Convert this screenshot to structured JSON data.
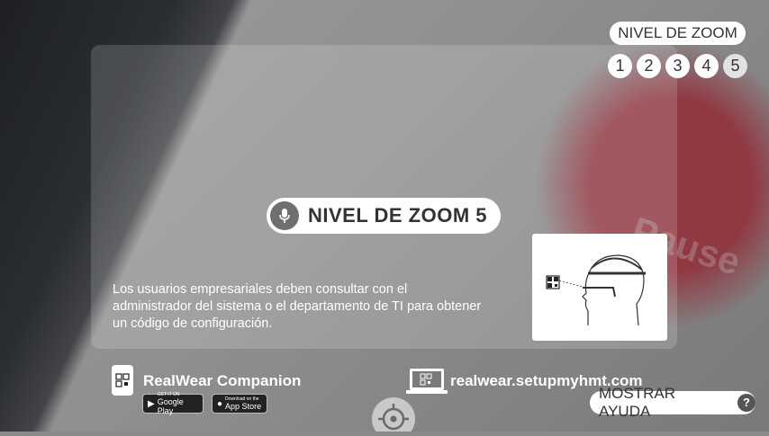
{
  "camera": {
    "background_text": "Pause",
    "accent_color": "#c94f5c"
  },
  "zoom": {
    "title": "NIVEL DE ZOOM",
    "levels": [
      "1",
      "2",
      "3",
      "4",
      "5"
    ],
    "current_level": 5,
    "indicator_label": "NIVEL DE ZOOM 5",
    "indicator_icon": "microphone-icon"
  },
  "info": {
    "admin_message": "Los usuarios empresariales deben consultar con el administrador del sistema o el departamento de TI para obtener un código de configuración."
  },
  "bottom": {
    "companion_title": "RealWear Companion",
    "google_play": {
      "small": "GET IT ON",
      "big": "Google Play"
    },
    "app_store": {
      "small": "Download on the",
      "big": "App Store"
    },
    "setup_url": "realwear.setupmyhmt.com",
    "help_label": "MOSTRAR AYUDA",
    "help_icon": "?"
  }
}
